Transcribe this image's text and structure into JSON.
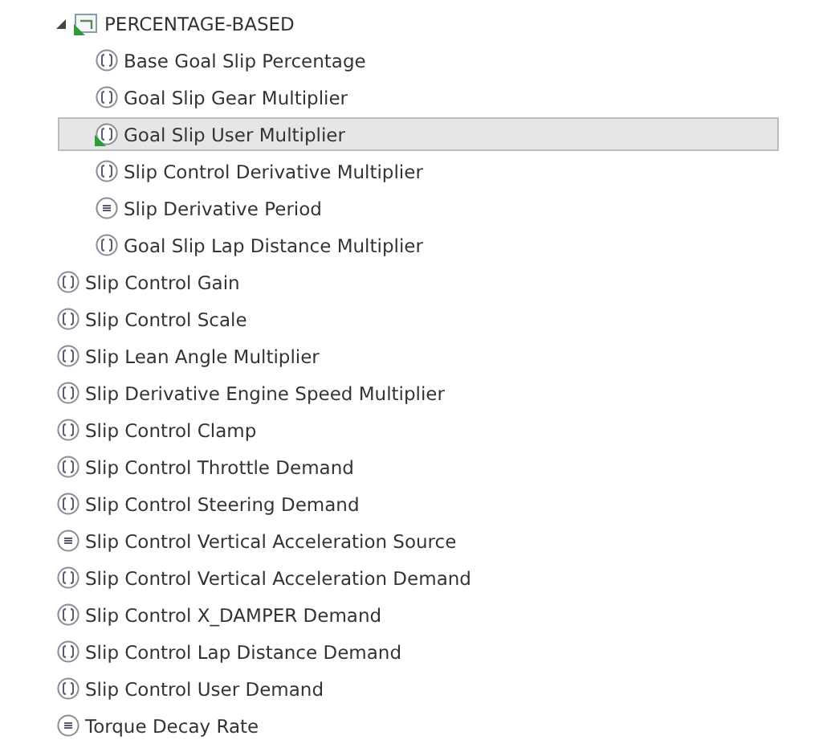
{
  "tree": [
    {
      "kind": "folder",
      "label": "PERCENTAGE-BASED",
      "expanded": true,
      "selected": false,
      "modified": true,
      "children": [
        {
          "kind": "scalar",
          "label": "Base Goal Slip Percentage",
          "selected": false,
          "modified": false
        },
        {
          "kind": "scalar",
          "label": "Goal Slip Gear Multiplier",
          "selected": false,
          "modified": false
        },
        {
          "kind": "scalar",
          "label": "Goal Slip User Multiplier",
          "selected": true,
          "modified": true
        },
        {
          "kind": "scalar",
          "label": "Slip Control Derivative Multiplier",
          "selected": false,
          "modified": false
        },
        {
          "kind": "enum",
          "label": "Slip Derivative Period",
          "selected": false,
          "modified": false
        },
        {
          "kind": "scalar",
          "label": "Goal Slip Lap Distance Multiplier",
          "selected": false,
          "modified": false
        }
      ]
    },
    {
      "kind": "scalar",
      "label": "Slip Control Gain",
      "selected": false,
      "modified": false
    },
    {
      "kind": "scalar",
      "label": "Slip Control Scale",
      "selected": false,
      "modified": false
    },
    {
      "kind": "scalar",
      "label": "Slip Lean Angle Multiplier",
      "selected": false,
      "modified": false
    },
    {
      "kind": "scalar",
      "label": "Slip Derivative Engine Speed Multiplier",
      "selected": false,
      "modified": false
    },
    {
      "kind": "scalar",
      "label": "Slip Control Clamp",
      "selected": false,
      "modified": false
    },
    {
      "kind": "scalar",
      "label": "Slip Control Throttle Demand",
      "selected": false,
      "modified": false
    },
    {
      "kind": "scalar",
      "label": "Slip Control Steering Demand",
      "selected": false,
      "modified": false
    },
    {
      "kind": "enum",
      "label": "Slip Control Vertical Acceleration Source",
      "selected": false,
      "modified": false
    },
    {
      "kind": "scalar",
      "label": "Slip Control Vertical Acceleration Demand",
      "selected": false,
      "modified": false
    },
    {
      "kind": "scalar",
      "label": "Slip Control X_DAMPER Demand",
      "selected": false,
      "modified": false
    },
    {
      "kind": "scalar",
      "label": "Slip Control Lap Distance Demand",
      "selected": false,
      "modified": false
    },
    {
      "kind": "scalar",
      "label": "Slip Control User Demand",
      "selected": false,
      "modified": false
    },
    {
      "kind": "enum",
      "label": "Torque Decay Rate",
      "selected": false,
      "modified": false
    }
  ]
}
